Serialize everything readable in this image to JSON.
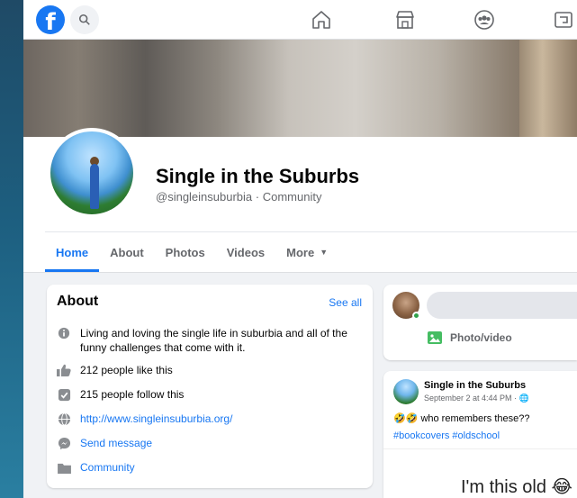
{
  "colors": {
    "brand": "#1877f2",
    "online": "#31a24c"
  },
  "nav": {
    "icons": [
      "facebook-logo",
      "search-icon",
      "home-icon",
      "marketplace-icon",
      "groups-icon",
      "gaming-icon"
    ]
  },
  "page": {
    "title": "Single in the Suburbs",
    "subtitle": "@singleinsuburbia · Community"
  },
  "tabs": [
    {
      "label": "Home",
      "active": true
    },
    {
      "label": "About"
    },
    {
      "label": "Photos"
    },
    {
      "label": "Videos"
    },
    {
      "label": "More"
    }
  ],
  "about": {
    "title": "About",
    "see_all": "See all",
    "items": [
      {
        "icon": "info-icon",
        "text": "Living and loving the single life in suburbia and all of the funny challenges that come with it."
      },
      {
        "icon": "like-icon",
        "text": "212 people like this"
      },
      {
        "icon": "follow-icon",
        "text": "215 people follow this"
      },
      {
        "icon": "globe-icon",
        "text": "http://www.singleinsuburbia.org/",
        "link": true
      },
      {
        "icon": "messenger-icon",
        "text": "Send message",
        "link": true
      },
      {
        "icon": "category-icon",
        "text": "Community",
        "link": true
      }
    ]
  },
  "composer": {
    "action_label": "Photo/video"
  },
  "post": {
    "author": "Single in the Suburbs",
    "meta": "September 2 at 4:44 PM · 🌐",
    "text": "🤣🤣 who remembers these??",
    "tags": "#bookcovers #oldschool",
    "image_caption": "I'm this old 😂"
  }
}
